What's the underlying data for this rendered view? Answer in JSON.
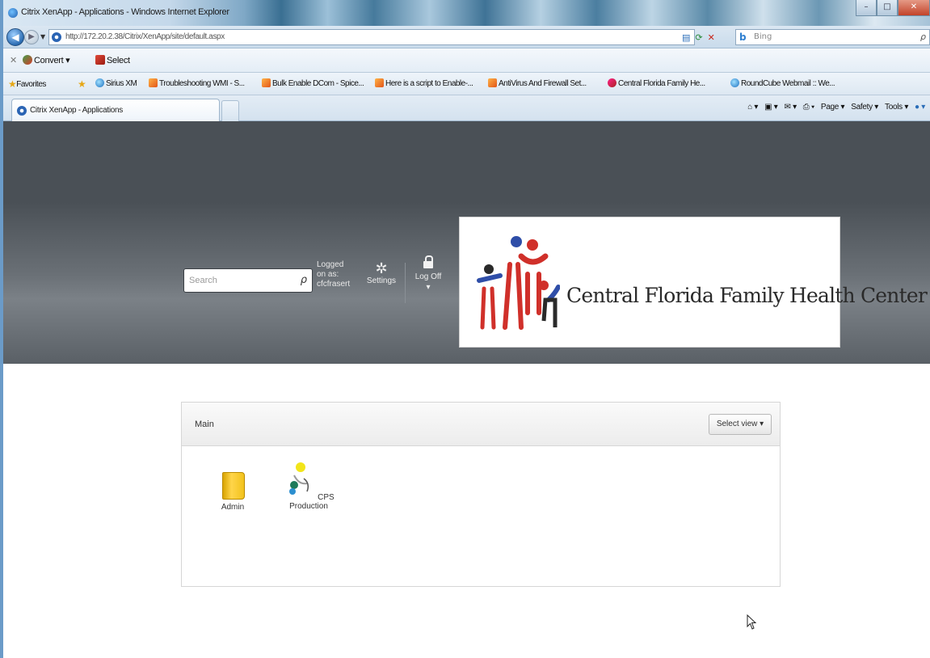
{
  "window": {
    "title": "Citrix XenApp - Applications - Windows Internet Explorer",
    "buttons": {
      "minimize": "–",
      "maximize": "□",
      "close": "✕"
    }
  },
  "address_bar": {
    "url": "http://172.20.2.38/Citrix/XenApp/site/default.aspx",
    "search_placeholder": "Bing"
  },
  "command_bar": {
    "convert": "Convert",
    "select": "Select"
  },
  "favorites_bar": {
    "favorites_label": "Favorites",
    "items": [
      "Sirius XM",
      "Troubleshooting WMI - S...",
      "Bulk Enable DCom - Spice...",
      "Here is a script to Enable-...",
      "AntiVirus And Firewall Set...",
      "Central Florida Family He...",
      "RoundCube Webmail :: We..."
    ]
  },
  "tabs": {
    "active_label": "Citrix XenApp - Applications",
    "tools": [
      "Page ▾",
      "Safety ▾",
      "Tools ▾"
    ]
  },
  "citrix": {
    "search_placeholder": "Search",
    "logged_on_as": "Logged on as:",
    "username": "cfcfrasert",
    "settings_label": "Settings",
    "log_off_label": "Log Off ▾",
    "logo_text": "Central Florida Family Health Center"
  },
  "panel": {
    "title": "Main",
    "select_view": "Select view ▾",
    "apps": [
      {
        "label": "Admin",
        "icon": "folder-icon"
      },
      {
        "label": "CPS Production",
        "icon": "cps-app-icon"
      }
    ]
  }
}
